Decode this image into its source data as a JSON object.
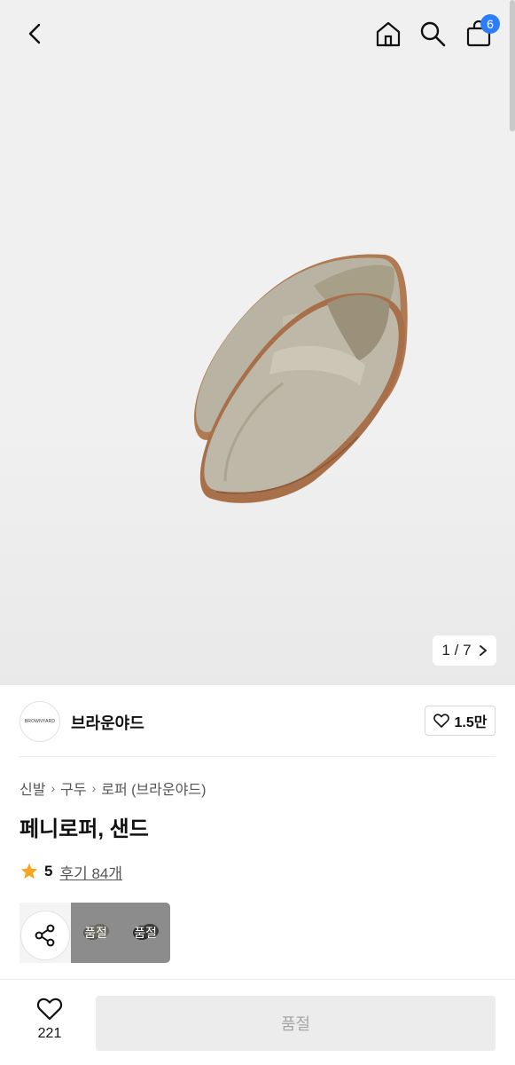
{
  "header": {
    "cart_count": "6",
    "icons": [
      "back-arrow-icon",
      "home-icon",
      "search-icon",
      "shopping-bag-icon"
    ]
  },
  "gallery": {
    "current": "1",
    "separator": "/",
    "total": "7"
  },
  "brand": {
    "logo_text": "BROWNYARD",
    "name": "브라운야드",
    "like_count": "1.5만"
  },
  "breadcrumb": [
    "신발",
    "구두",
    "로퍼 (브라운야드)"
  ],
  "product": {
    "title": "페니로퍼, 샌드",
    "rating": "5",
    "review_text": "후기 84개"
  },
  "options": {
    "items": [
      {
        "label": "품절"
      },
      {
        "label": "품절"
      }
    ]
  },
  "bottom_bar": {
    "wish_count": "221",
    "buy_label": "품절"
  },
  "colors": {
    "badge": "#2f7df6",
    "star": "#f5a623",
    "soldout_button": "#ececec"
  }
}
